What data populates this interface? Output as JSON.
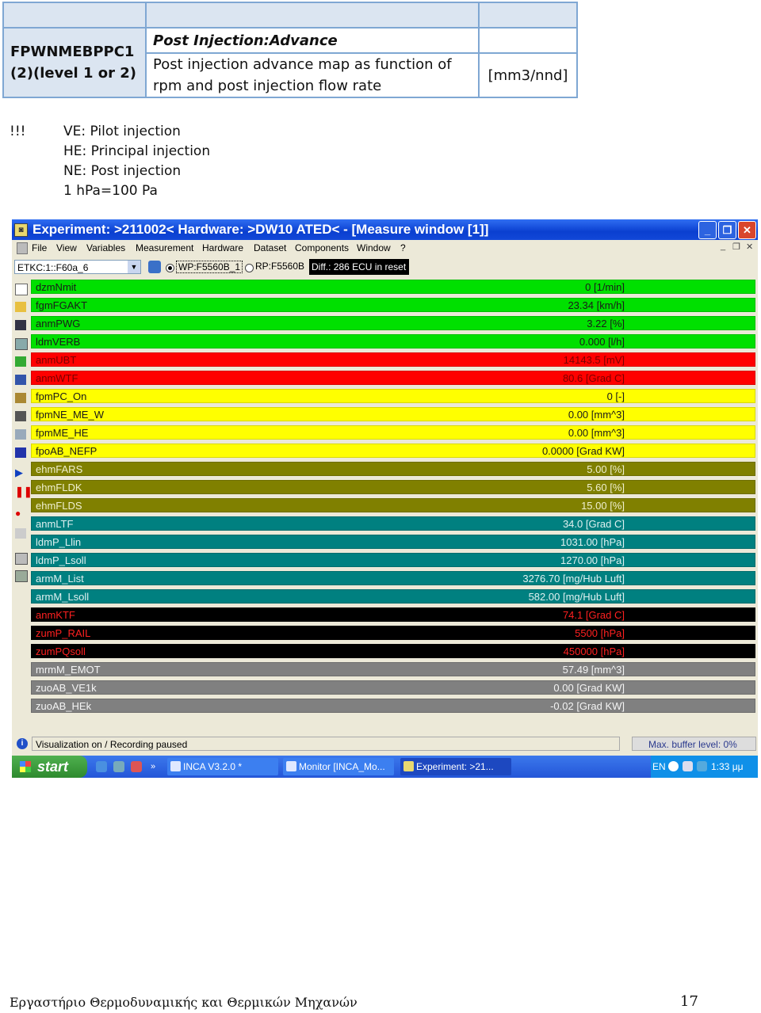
{
  "doc_table": {
    "code": "FPWNMEBPPC1 (2)(level 1 or 2)",
    "title": "Post Injection:Advance",
    "description": "Post injection advance map as function of rpm and post injection flow rate",
    "unit": "[mm3/nnd]"
  },
  "notes": {
    "bang": "!!!",
    "lines": [
      "VE: Pilot injection",
      "HE: Principal injection",
      "NE: Post injection",
      "1 hPa=100 Pa"
    ]
  },
  "window": {
    "title": "Experiment: >211002< Hardware: >DW10 ATED< - [Measure window [1]]",
    "buttons": {
      "minimize": "_",
      "restore": "❐",
      "close": "✕"
    },
    "menu": [
      "File",
      "View",
      "Variables",
      "Measurement",
      "Hardware",
      "Dataset",
      "Components",
      "Window",
      "?"
    ],
    "mdi_buttons": [
      "_",
      "❐",
      "✕"
    ],
    "toolbar": {
      "device": "ETKC:1::F60a_6",
      "wp_label": "WP:F5560B_1",
      "rp_label": "RP:F5560B",
      "diff_label": "Diff.: 286  ECU in reset"
    },
    "rows": [
      {
        "name": "dzmNmit",
        "value": "0 [1/min]",
        "bg": "#00e000",
        "fg": "#1a1a1a"
      },
      {
        "name": "fgmFGAKT",
        "value": "23.34 [km/h]",
        "bg": "#00e000",
        "fg": "#1a1a1a"
      },
      {
        "name": "anmPWG",
        "value": "3.22 [%]",
        "bg": "#00e000",
        "fg": "#1a1a1a"
      },
      {
        "name": "ldmVERB",
        "value": "0.000 [l/h]",
        "bg": "#00e000",
        "fg": "#1a1a1a"
      },
      {
        "name": "anmUBT",
        "value": "14143.5 [mV]",
        "bg": "#ff0000",
        "fg": "#7a0000"
      },
      {
        "name": "anmWTF",
        "value": "80.6 [Grad C]",
        "bg": "#ff0000",
        "fg": "#7a0000"
      },
      {
        "name": "fpmPC_On",
        "value": "0 [-]",
        "bg": "#ffff00",
        "fg": "#1a1a1a"
      },
      {
        "name": "fpmNE_ME_W",
        "value": "0.00 [mm^3]",
        "bg": "#ffff00",
        "fg": "#1a1a1a"
      },
      {
        "name": "fpmME_HE",
        "value": "0.00 [mm^3]",
        "bg": "#ffff00",
        "fg": "#1a1a1a"
      },
      {
        "name": "fpoAB_NEFP",
        "value": "0.0000 [Grad KW]",
        "bg": "#ffff00",
        "fg": "#1a1a1a"
      },
      {
        "name": "ehmFARS",
        "value": "5.00 [%]",
        "bg": "#808000",
        "fg": "#f0f0d0"
      },
      {
        "name": "ehmFLDK",
        "value": "5.60 [%]",
        "bg": "#808000",
        "fg": "#f0f0d0"
      },
      {
        "name": "ehmFLDS",
        "value": "15.00 [%]",
        "bg": "#808000",
        "fg": "#f0f0d0"
      },
      {
        "name": "anmLTF",
        "value": "34.0 [Grad C]",
        "bg": "#008080",
        "fg": "#e0f0f0"
      },
      {
        "name": "ldmP_Llin",
        "value": "1031.00 [hPa]",
        "bg": "#008080",
        "fg": "#e0f0f0"
      },
      {
        "name": "ldmP_Lsoll",
        "value": "1270.00 [hPa]",
        "bg": "#008080",
        "fg": "#e0f0f0"
      },
      {
        "name": "armM_List",
        "value": "3276.70 [mg/Hub Luft]",
        "bg": "#008080",
        "fg": "#e0f0f0"
      },
      {
        "name": "armM_Lsoll",
        "value": "582.00 [mg/Hub Luft]",
        "bg": "#008080",
        "fg": "#e0f0f0"
      },
      {
        "name": "anmKTF",
        "value": "74.1 [Grad C]",
        "bg": "#000000",
        "fg": "#ff2020"
      },
      {
        "name": "zumP_RAIL",
        "value": "5500 [hPa]",
        "bg": "#000000",
        "fg": "#ff2020"
      },
      {
        "name": "zumPQsoll",
        "value": "450000 [hPa]",
        "bg": "#000000",
        "fg": "#ff2020"
      },
      {
        "name": "mrmM_EMOT",
        "value": "57.49 [mm^3]",
        "bg": "#808080",
        "fg": "#f4f4f4"
      },
      {
        "name": "zuoAB_VE1k",
        "value": "0.00 [Grad KW]",
        "bg": "#808080",
        "fg": "#f4f4f4"
      },
      {
        "name": "zuoAB_HEk",
        "value": "-0.02 [Grad KW]",
        "bg": "#808080",
        "fg": "#f4f4f4"
      }
    ],
    "status": {
      "text": "Visualization on / Recording paused",
      "buffer": "Max. buffer level: 0%"
    },
    "taskbar": {
      "start": "start",
      "tasks": [
        "INCA V3.2.0 *",
        "Monitor [INCA_Mo...",
        "Experiment: >21..."
      ],
      "lang": "EN",
      "time": "1:33 μμ"
    }
  },
  "footer": {
    "text": "Εργαστήριο Θερμοδυναμικής και Θερμικών Μηχανών",
    "page": "17"
  }
}
